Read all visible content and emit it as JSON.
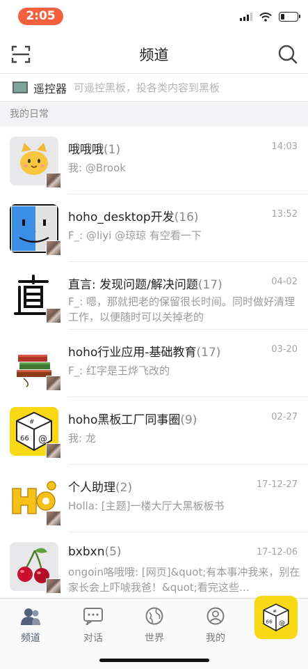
{
  "status_bar": {
    "time": "2:05",
    "accent_color": "#f2603d"
  },
  "nav": {
    "title": "频道",
    "scan_icon": "scan-icon",
    "search_icon": "search-icon"
  },
  "remote": {
    "label": "遥控器",
    "hint": "可遥控黑板，投各类内容到黑板"
  },
  "section": {
    "title": "我的日常"
  },
  "channels": [
    {
      "name": "哦哦哦",
      "count": "(1)",
      "time": "14:03",
      "preview": "我: @Brook",
      "avatar": "cat-emoji"
    },
    {
      "name": "hoho_desktop开发",
      "count": "(16)",
      "time": "13:52",
      "preview": "F_: @liyi @琼琼 有空看一下",
      "avatar": "finder-icon"
    },
    {
      "name": "直言: 发现问题/解决问题",
      "count": "(17)",
      "time": "04-02",
      "preview": "F_: 嗯，那就把老的保留很长时间。同时做好清理工作，以便随时可以关掉老的",
      "avatar": "calligraphy-zhi"
    },
    {
      "name": "hoho行业应用-基础教育",
      "count": "(17)",
      "time": "03-20",
      "preview": "F_: 红字是王烨飞改的",
      "avatar": "books-icon"
    },
    {
      "name": "hoho黑板工厂同事圈",
      "count": "(9)",
      "time": "02-27",
      "preview": "我: 龙",
      "avatar": "hoho-dice-logo"
    },
    {
      "name": "个人助理",
      "count": "(2)",
      "time": "17-12-27",
      "preview": "Holla: [主题]一楼大厅大黑板板书",
      "avatar": "hoho-puzzle-logo"
    },
    {
      "name": "bxbxn",
      "count": "(5)",
      "time": "17-12-06",
      "preview": "ongoin咯哦哦: [网页]&quot;有本事冲我来，别在家长会上吓唬我爸！&quot;看完这些…",
      "avatar": "cherry-icon"
    }
  ],
  "tabs": [
    {
      "label": "频道",
      "icon": "people-icon",
      "active": true
    },
    {
      "label": "对话",
      "icon": "chat-bubble-icon",
      "active": false
    },
    {
      "label": "世界",
      "icon": "globe-icon",
      "active": false
    },
    {
      "label": "我的",
      "icon": "profile-icon",
      "active": false
    }
  ],
  "fab": {
    "icon": "hoho-dice-logo",
    "color": "#f8d916"
  }
}
